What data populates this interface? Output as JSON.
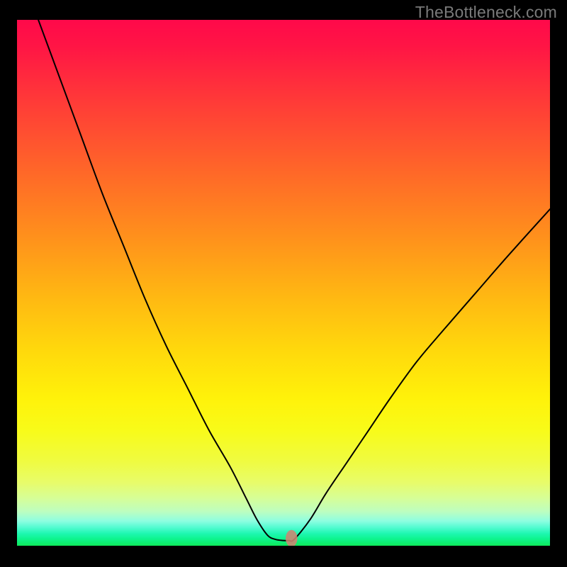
{
  "watermark": "TheBottleneck.com",
  "chart_data": {
    "type": "line",
    "title": "",
    "xlabel": "",
    "ylabel": "",
    "xlim": [
      0,
      100
    ],
    "ylim": [
      0,
      100
    ],
    "annotations": [],
    "series": [
      {
        "name": "left-curve",
        "x": [
          4,
          8,
          12,
          16,
          20,
          24,
          28,
          32,
          36,
          40,
          43,
          45,
          47
        ],
        "y": [
          100,
          89,
          78,
          67,
          57,
          47,
          38,
          30,
          22,
          15,
          9,
          5,
          2
        ]
      },
      {
        "name": "valley-floor",
        "x": [
          47,
          48.5,
          50,
          51,
          52
        ],
        "y": [
          2,
          1.2,
          1,
          1,
          1.2
        ]
      },
      {
        "name": "right-curve",
        "x": [
          52,
          55,
          58,
          62,
          66,
          70,
          75,
          80,
          86,
          92,
          100
        ],
        "y": [
          1.2,
          5,
          10,
          16,
          22,
          28,
          35,
          41,
          48,
          55,
          64
        ]
      }
    ],
    "marker": {
      "name": "bottleneck-point",
      "x": 51.5,
      "y": 1.4,
      "rx": 1.1,
      "ry": 1.6
    },
    "background": "red-yellow-green-vertical-gradient"
  }
}
